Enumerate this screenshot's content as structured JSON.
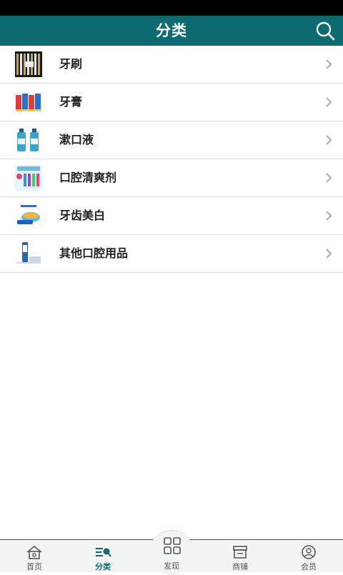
{
  "header": {
    "title": "分类",
    "search_icon": "search-icon"
  },
  "categories": [
    {
      "label": "牙刷",
      "icon": "toothbrush-thumbnail"
    },
    {
      "label": "牙膏",
      "icon": "toothpaste-thumbnail"
    },
    {
      "label": "漱口液",
      "icon": "mouthwash-thumbnail"
    },
    {
      "label": "口腔清爽剂",
      "icon": "mouth-freshener-thumbnail"
    },
    {
      "label": "牙齿美白",
      "icon": "teeth-whitening-thumbnail"
    },
    {
      "label": "其他口腔用品",
      "icon": "other-oral-care-thumbnail"
    }
  ],
  "tabbar": {
    "home": "首页",
    "category": "分类",
    "discover": "发现",
    "shop": "商铺",
    "member": "会员"
  },
  "colors": {
    "primary": "#0c6a70",
    "status_bar": "#000000"
  }
}
